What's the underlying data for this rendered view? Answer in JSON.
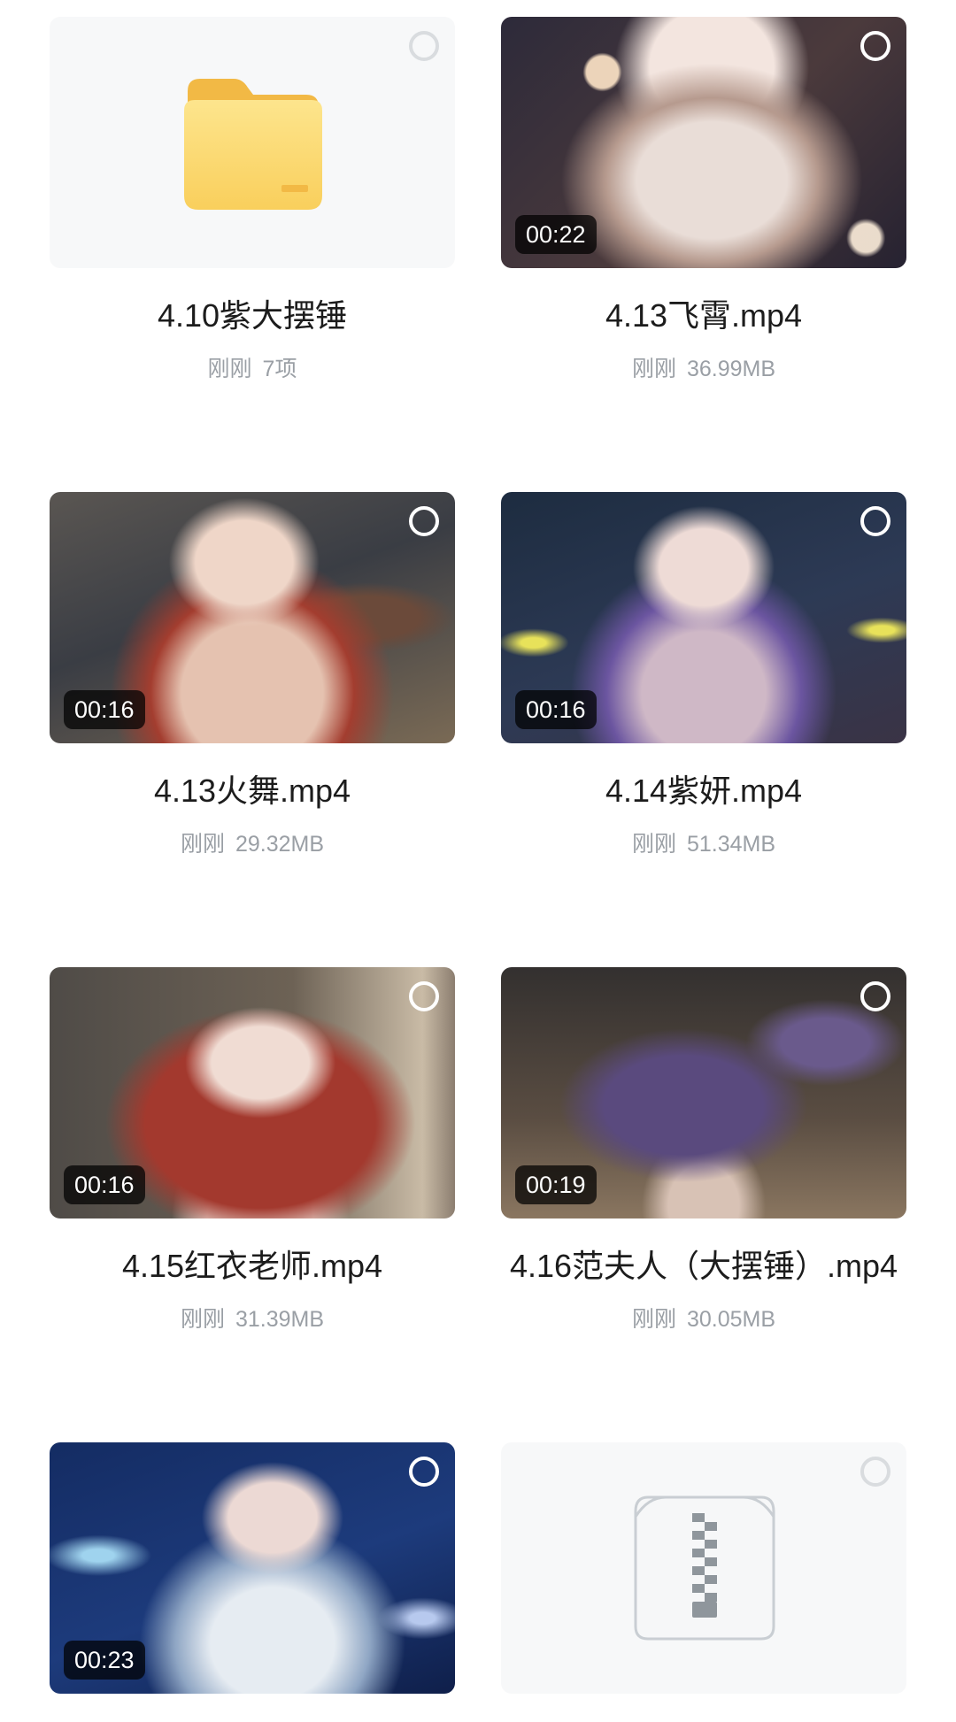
{
  "items": [
    {
      "name": "4.10紫大摆锤",
      "time": "刚刚",
      "size": "7项",
      "type": "folder"
    },
    {
      "name": "4.13飞霄.mp4",
      "time": "刚刚",
      "size": "36.99MB",
      "duration": "00:22",
      "type": "video"
    },
    {
      "name": "4.13火舞.mp4",
      "time": "刚刚",
      "size": "29.32MB",
      "duration": "00:16",
      "type": "video"
    },
    {
      "name": "4.14紫妍.mp4",
      "time": "刚刚",
      "size": "51.34MB",
      "duration": "00:16",
      "type": "video"
    },
    {
      "name": "4.15红衣老师.mp4",
      "time": "刚刚",
      "size": "31.39MB",
      "duration": "00:16",
      "type": "video"
    },
    {
      "name": "4.16范夫人（大摆锤）.mp4",
      "time": "刚刚",
      "size": "30.05MB",
      "duration": "00:19",
      "type": "video"
    },
    {
      "name": "",
      "time": "",
      "size": "",
      "duration": "00:23",
      "type": "video"
    },
    {
      "name": "",
      "time": "",
      "size": "",
      "type": "archive"
    }
  ],
  "colors": {
    "folder": "#f9d56e",
    "folder_dark": "#f2b945",
    "badge_bg": "#000000",
    "meta_text": "#9a9fa5"
  },
  "icons": {
    "folder": "folder-icon",
    "archive": "zip-archive-icon",
    "select": "select-circle-icon"
  }
}
